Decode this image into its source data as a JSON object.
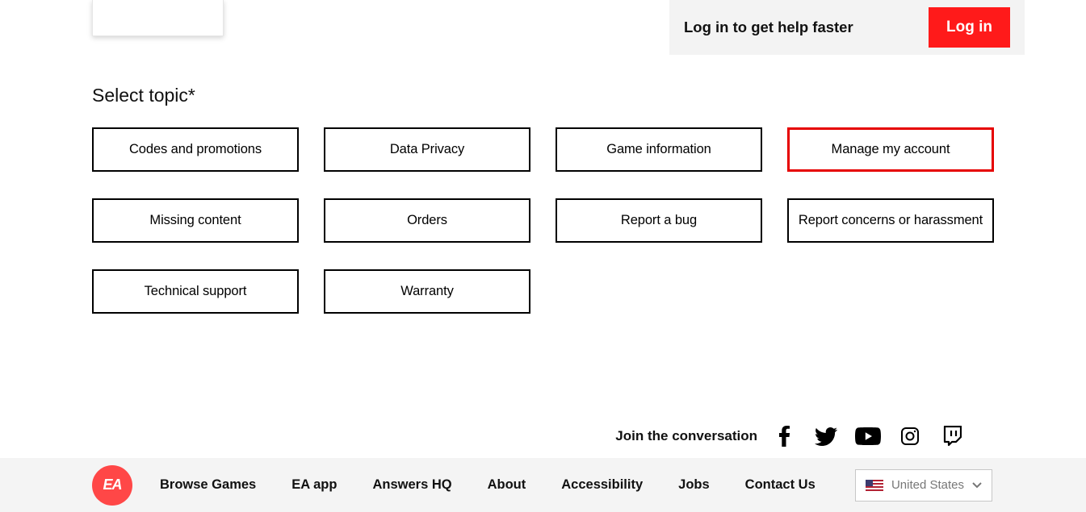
{
  "login_bar": {
    "text": "Log in to get help faster",
    "button": "Log in"
  },
  "select_topic_heading": "Select topic*",
  "topics": [
    "Codes and promotions",
    "Data Privacy",
    "Game information",
    "Manage my account",
    "Missing content",
    "Orders",
    "Report a bug",
    "Report concerns or harassment",
    "Technical support",
    "Warranty"
  ],
  "selected_topic_index": 3,
  "conversation_label": "Join the conversation",
  "footer": {
    "logo_text": "EA",
    "links": [
      "Browse Games",
      "EA app",
      "Answers HQ",
      "About",
      "Accessibility",
      "Jobs",
      "Contact Us"
    ],
    "country": "United States"
  }
}
